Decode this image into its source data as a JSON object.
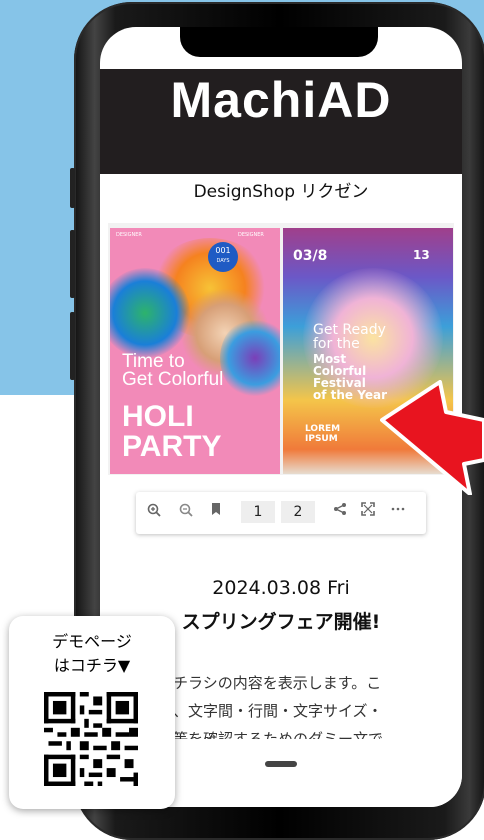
{
  "colors": {
    "background_band": "#86c4e8",
    "header_bg": "#221e1f",
    "arrow": "#e8141f",
    "badge": "#1f5bc4"
  },
  "app": {
    "logo": "MachiAD",
    "shop_title": "DesignShop リクゼン"
  },
  "flyer": {
    "left_page": {
      "small_top_left": "DESIGNER",
      "small_top_right": "DESIGNER",
      "badge_top": "001",
      "badge_bottom": "DAYS",
      "title_line1": "Time to",
      "title_line2": "Get Colorful",
      "big_line1": "HOLI",
      "big_line2": "PARTY"
    },
    "right_page": {
      "date": "03/8",
      "number": "13",
      "line1": "Get Ready",
      "line2": "for the",
      "line3": "Most",
      "line4": "Colorful",
      "line5": "Festival",
      "line6": "of the Year",
      "footer1": "LOREM",
      "footer2": "IPSUM"
    }
  },
  "toolbar": {
    "zoom_in_icon": "zoom-in-icon",
    "zoom_out_icon": "zoom-out-icon",
    "bookmark_icon": "bookmark-icon",
    "page1": "1",
    "page2": "2",
    "share_icon": "share-icon",
    "fullscreen_icon": "fullscreen-icon",
    "more_icon": "more-icon"
  },
  "article": {
    "date": "2024.03.08 Fri",
    "event": "スプリングフェア開催!",
    "body_line1": "はチラシの内容を表示します。こ",
    "body_line2": "は、文字間・行間・文字サイズ・",
    "body_line3": "隔等を確認するためのダミー文で"
  },
  "qr_card": {
    "line1": "デモページ",
    "line2": "はコチラ▼"
  }
}
